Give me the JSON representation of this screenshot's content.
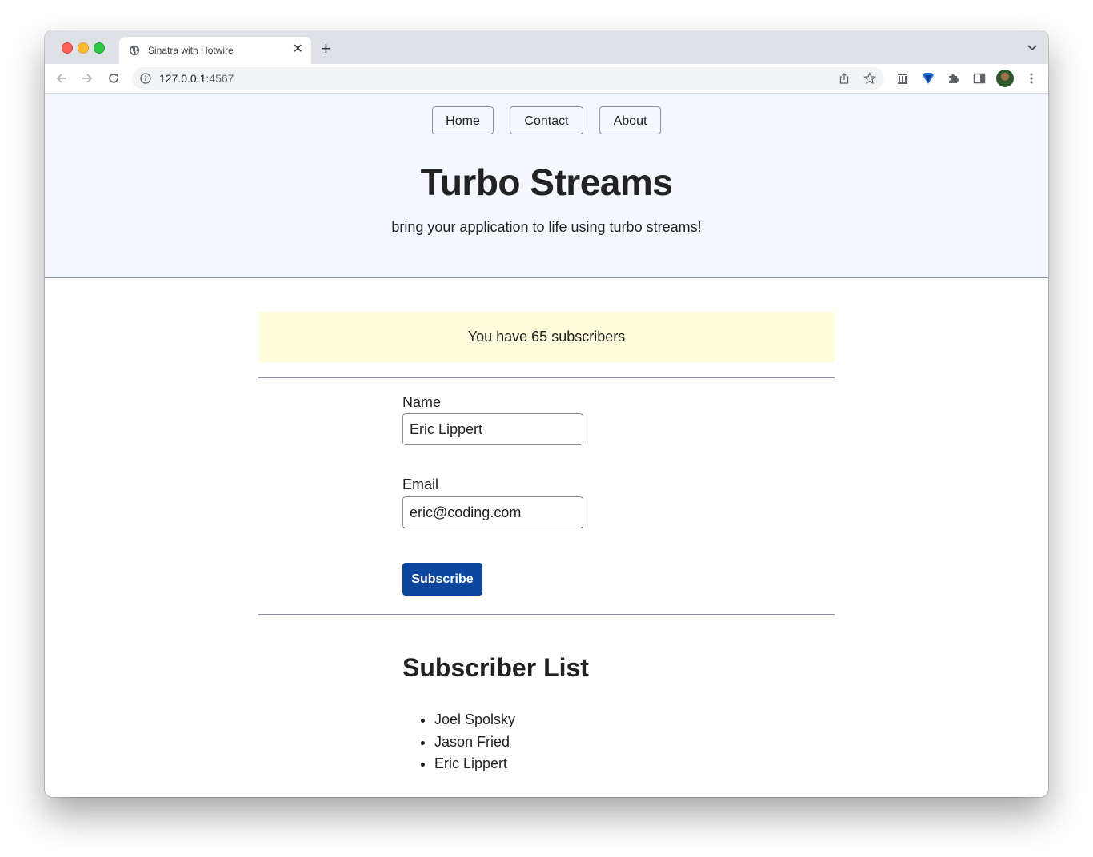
{
  "browser": {
    "tab_title": "Sinatra with Hotwire",
    "tab_icon": "globe-icon",
    "url_host": "127.0.0.1",
    "url_port": ":4567",
    "new_tab_label": "+",
    "close_tab_label": "✕"
  },
  "page": {
    "nav": [
      {
        "label": "Home"
      },
      {
        "label": "Contact"
      },
      {
        "label": "About"
      }
    ],
    "title": "Turbo Streams",
    "tagline": "bring your application to life using turbo streams!",
    "notice": "You have 65 subscribers",
    "form": {
      "name_label": "Name",
      "name_value": "Eric Lippert",
      "email_label": "Email",
      "email_value": "eric@coding.com",
      "submit_label": "Subscribe"
    },
    "subscriber_list": {
      "title": "Subscriber List",
      "items": [
        "Joel Spolsky",
        "Jason Fried",
        "Eric Lippert"
      ]
    }
  },
  "colors": {
    "hero_bg": "#f4f7ff",
    "notice_bg": "#fffddc",
    "button_bg": "#0b47a1"
  }
}
